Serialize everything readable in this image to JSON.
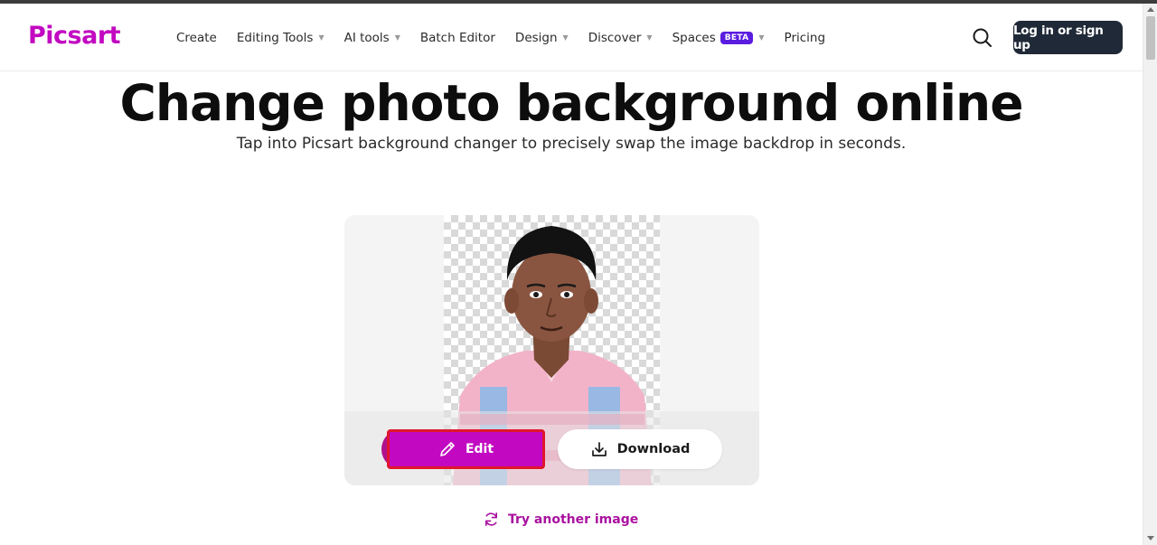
{
  "brand": {
    "name": "Picsart",
    "accent": "#c209c1",
    "dark": "#1f2937",
    "beta_color": "#5a1de0"
  },
  "nav": [
    {
      "label": "Create",
      "dropdown": false
    },
    {
      "label": "Editing Tools",
      "dropdown": true
    },
    {
      "label": "AI tools",
      "dropdown": true
    },
    {
      "label": "Batch Editor",
      "dropdown": false
    },
    {
      "label": "Design",
      "dropdown": true
    },
    {
      "label": "Discover",
      "dropdown": true
    },
    {
      "label": "Spaces",
      "dropdown": true,
      "badge": "BETA"
    },
    {
      "label": "Pricing",
      "dropdown": false
    }
  ],
  "header": {
    "search_icon": "search-icon",
    "login_label": "Log in or sign up"
  },
  "hero": {
    "title": "Change photo background online",
    "subtitle": "Tap into Picsart background changer to precisely swap the image backdrop in seconds."
  },
  "preview": {
    "edit_label": "Edit",
    "edit_icon": "pencil-icon",
    "download_label": "Download",
    "download_icon": "download-icon",
    "try_label": "Try another image",
    "try_icon": "refresh-icon"
  }
}
